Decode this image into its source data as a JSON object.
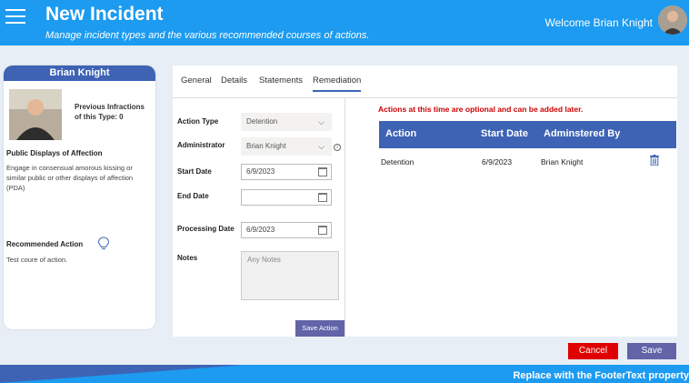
{
  "header": {
    "title": "New Incident",
    "subtitle": "Manage incident types and the various recommended courses of actions.",
    "welcome": "Welcome Brian Knight"
  },
  "student": {
    "name": "Brian Knight",
    "previous_infractions": "Previous Infractions of this Type: 0",
    "infraction_title": "Public Displays of Affection",
    "infraction_desc": "Engage in consensual amorous kissing or similar public or other displays of affection (PDA)",
    "recommended_label": "Recommended Action",
    "recommended_text": "Test coure of action."
  },
  "tabs": [
    {
      "label": "General"
    },
    {
      "label": "Details"
    },
    {
      "label": "Statements"
    },
    {
      "label": "Remediation"
    }
  ],
  "form": {
    "action_type_label": "Action Type",
    "action_type_value": "Detention",
    "administrator_label": "Administrator",
    "administrator_value": "Brian Knight",
    "start_date_label": "Start Date",
    "start_date_value": "6/9/2023",
    "end_date_label": "End Date",
    "end_date_value": "",
    "processing_date_label": "Processing Date",
    "processing_date_value": "6/9/2023",
    "notes_label": "Notes",
    "notes_placeholder": "Any Notes",
    "save_action_label": "Save Action"
  },
  "notice": "Actions at this time are optional and can be added later.",
  "table": {
    "headers": [
      "Action",
      "Start Date",
      "Adminstered By"
    ],
    "rows": [
      {
        "action": "Detention",
        "start_date": "6/9/2023",
        "administered_by": "Brian Knight"
      }
    ]
  },
  "buttons": {
    "cancel": "Cancel",
    "save": "Save"
  },
  "footer": {
    "text": "Replace with the FooterText property"
  },
  "colors": {
    "header_blue": "#1c9bf0",
    "accent_navy": "#3e63b5",
    "purple": "#6264a7",
    "cancel_red": "#e00000"
  }
}
